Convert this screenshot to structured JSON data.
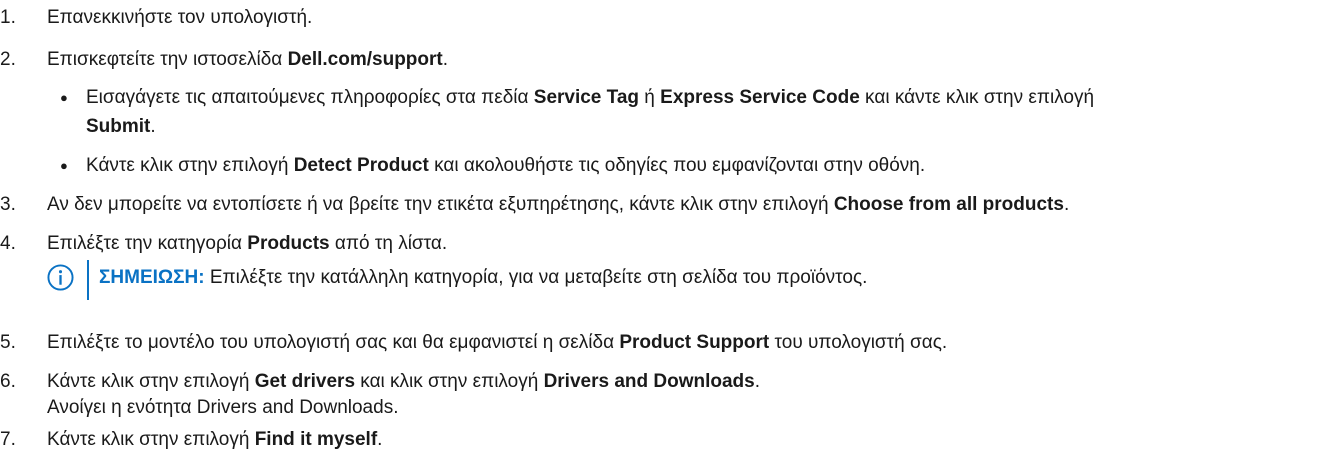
{
  "steps": [
    {
      "num": "1.",
      "parts": [
        "Επανεκκινήστε τον υπολογιστή."
      ]
    },
    {
      "num": "2.",
      "pre": "Επισκεφτείτε την ιστοσελίδα ",
      "bold": "Dell.com/support",
      "post": "."
    },
    {
      "num": "3.",
      "pre": "Αν δεν μπορείτε να εντοπίσετε ή να βρείτε την ετικέτα εξυπηρέτησης, κάντε κλικ στην επιλογή ",
      "bold": "Choose from all products",
      "post": "."
    },
    {
      "num": "4.",
      "pre": "Επιλέξτε την κατηγορία ",
      "bold": "Products",
      "post": " από τη λίστα."
    },
    {
      "num": "5.",
      "pre": "Επιλέξτε το μοντέλο του υπολογιστή σας και θα εμφανιστεί η σελίδα ",
      "bold": "Product Support",
      "post": " του υπολογιστή σας."
    },
    {
      "num": "6.",
      "pre": "Κάντε κλικ στην επιλογή ",
      "bold": "Get drivers",
      "mid": " και κλικ στην επιλογή ",
      "bold2": "Drivers and Downloads",
      "post": "."
    },
    {
      "num": "7.",
      "pre": "Κάντε κλικ στην επιλογή ",
      "bold": "Find it myself",
      "post": "."
    }
  ],
  "step2_bullets": [
    {
      "pre": "Εισαγάγετε τις απαιτούμενες πληροφορίες στα πεδία ",
      "bold": "Service Tag",
      "mid": " ή ",
      "bold2": "Express Service Code",
      "post": " και κάντε κλικ στην επιλογή",
      "cont_bold": "Submit",
      "cont_post": "."
    },
    {
      "pre": "Κάντε κλικ στην επιλογή ",
      "bold": "Detect Product",
      "post": " και ακολουθήστε τις οδηγίες που εμφανίζονται στην οθόνη."
    }
  ],
  "bullet_glyph": "●",
  "note": {
    "label": "ΣΗΜΕΙΩΣΗ:",
    "text": " Επιλέξτε την κατάλληλη κατηγορία, για να μεταβείτε στη σελίδα του προϊόντος.",
    "icon": "info-icon"
  },
  "step6_sub": "Ανοίγει η ενότητα Drivers and Downloads.",
  "colors": {
    "accent": "#0a72c4",
    "text": "#1a1a1a"
  }
}
